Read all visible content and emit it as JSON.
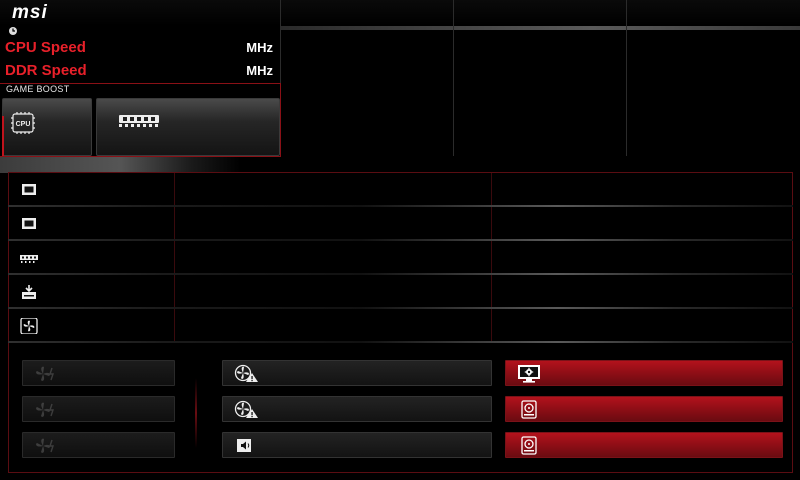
{
  "brand": {
    "logo_text": "msi"
  },
  "header": {
    "cpu_speed_label": "CPU Speed",
    "cpu_speed_unit": "MHz",
    "ddr_speed_label": "DDR Speed",
    "ddr_speed_unit": "MHz",
    "game_boost_label": "GAME BOOST",
    "cpu_button_label": "CPU"
  },
  "list": {
    "rows": [
      {
        "icon": "monitor-icon"
      },
      {
        "icon": "monitor-icon"
      },
      {
        "icon": "memory-icon"
      },
      {
        "icon": "storage-icon"
      },
      {
        "icon": "fan-icon"
      }
    ]
  },
  "buttons": {
    "left": [
      "fan-icon",
      "fan-icon",
      "fan-icon"
    ],
    "center": [
      "fan-warning-icon",
      "fan-warning-icon",
      "speaker-icon"
    ],
    "right": [
      "monitor-settings-icon",
      "hdd-icon",
      "hdd-icon"
    ]
  },
  "colors": {
    "accent": "#e8202a",
    "dark_red": "#8a1016",
    "button_red": "#b3121c"
  }
}
